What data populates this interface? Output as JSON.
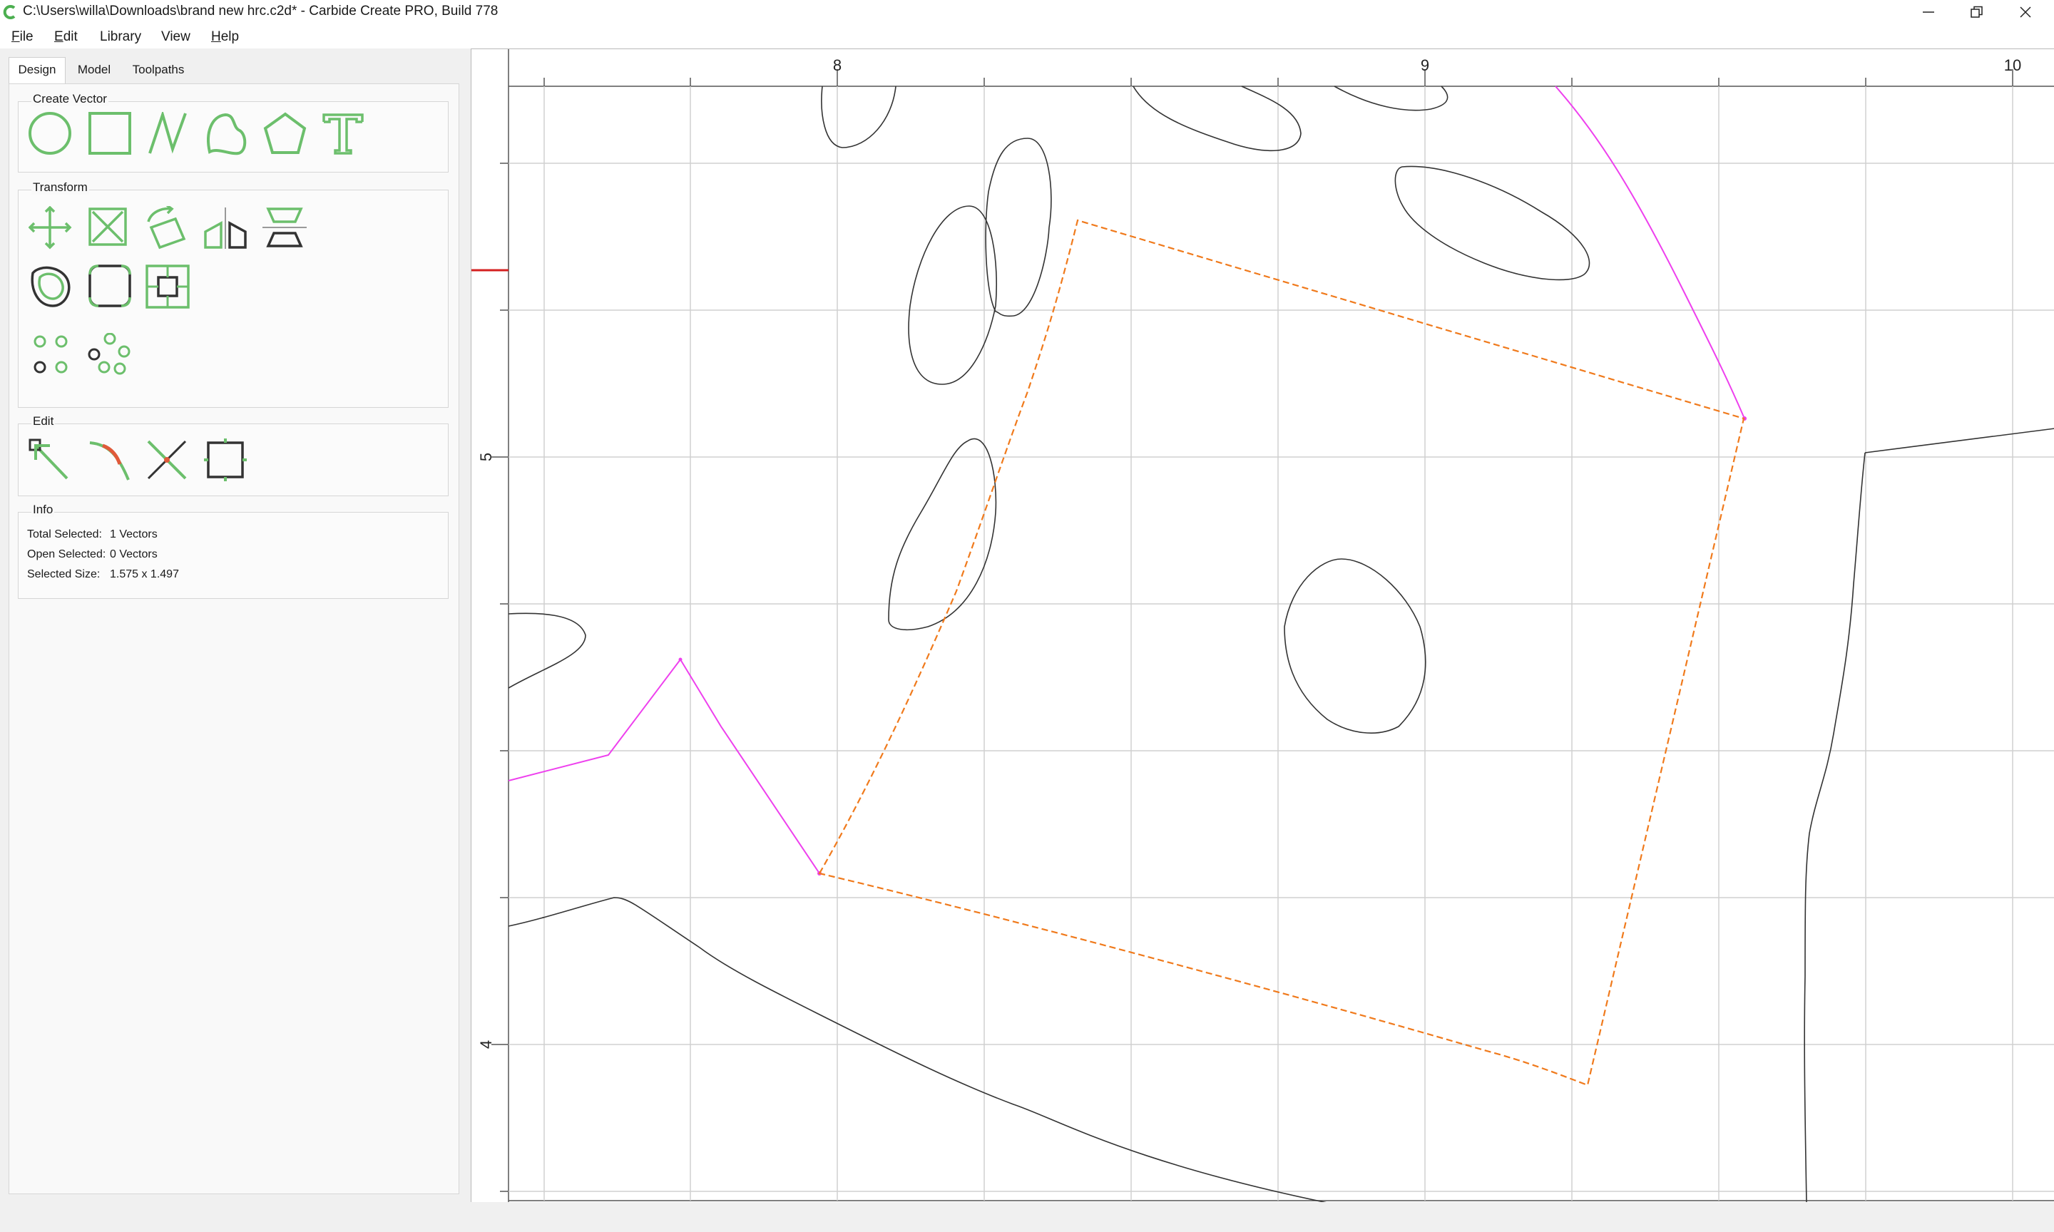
{
  "window": {
    "title": "C:\\Users\\willa\\Downloads\\brand new hrc.c2d* - Carbide Create PRO, Build 778"
  },
  "menu": [
    {
      "mnemonic": "F",
      "rest": "ile"
    },
    {
      "mnemonic": "E",
      "rest": "dit"
    },
    {
      "mnemonic": "",
      "rest": "Library"
    },
    {
      "mnemonic": "",
      "rest": "View"
    },
    {
      "mnemonic": "H",
      "rest": "elp"
    }
  ],
  "tabs": [
    "Design",
    "Model",
    "Toolpaths"
  ],
  "active_tab": "Design",
  "groups": {
    "create_vector": "Create Vector",
    "transform": "Transform",
    "edit": "Edit",
    "info": "Info"
  },
  "tools": {
    "create_vector": [
      "circle-icon",
      "rectangle-icon",
      "polyline-icon",
      "curve-icon",
      "polygon-icon",
      "text-icon"
    ],
    "transform": [
      "move-icon",
      "scale-icon",
      "rotate-icon",
      "mirror-icon",
      "align-icon",
      "offset-icon",
      "fillet-icon",
      "boolean-icon",
      "array-icon",
      "circular-array-icon"
    ],
    "edit": [
      "node-edit-icon",
      "curve-edit-icon",
      "trim-icon",
      "join-icon"
    ]
  },
  "info": {
    "total_selected_label": "Total Selected:",
    "total_selected_value": "1 Vectors",
    "open_selected_label": "Open Selected:",
    "open_selected_value": "0 Vectors",
    "selected_size_label": "Selected Size:",
    "selected_size_value": "1.575 x 1.497"
  },
  "rulers": {
    "top_labels": [
      "8",
      "9",
      "10"
    ],
    "left_labels": [
      "5",
      "4"
    ]
  },
  "colors": {
    "accent_green": "#6cbf6c",
    "selection_orange": "#f07a1c",
    "path_magenta": "#ee40ee",
    "vector_dark": "#333333",
    "ruler_marker_red": "#d42020"
  }
}
